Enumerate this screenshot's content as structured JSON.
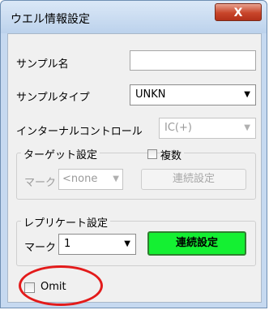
{
  "window": {
    "title": "ウエル情報設定",
    "close_label": "X"
  },
  "form": {
    "sample_name_label": "サンプル名",
    "sample_name_value": "",
    "sample_type_label": "サンプルタイプ",
    "sample_type_value": "UNKN",
    "internal_control_label": "インターナルコントロール",
    "internal_control_value": "IC(+)"
  },
  "target_group": {
    "title": "ターゲット設定",
    "multiple_label": "複数",
    "mark_label": "マーク",
    "mark_value": "<none",
    "continuous_button": "連続設定"
  },
  "replicate_group": {
    "title": "レプリケート設定",
    "mark_label": "マーク",
    "mark_value": "1",
    "continuous_button": "連続設定"
  },
  "omit": {
    "label": "Omit"
  },
  "colors": {
    "accent_green": "#14f032",
    "highlight_red": "#e31b1b",
    "close_red": "#c8452a"
  }
}
